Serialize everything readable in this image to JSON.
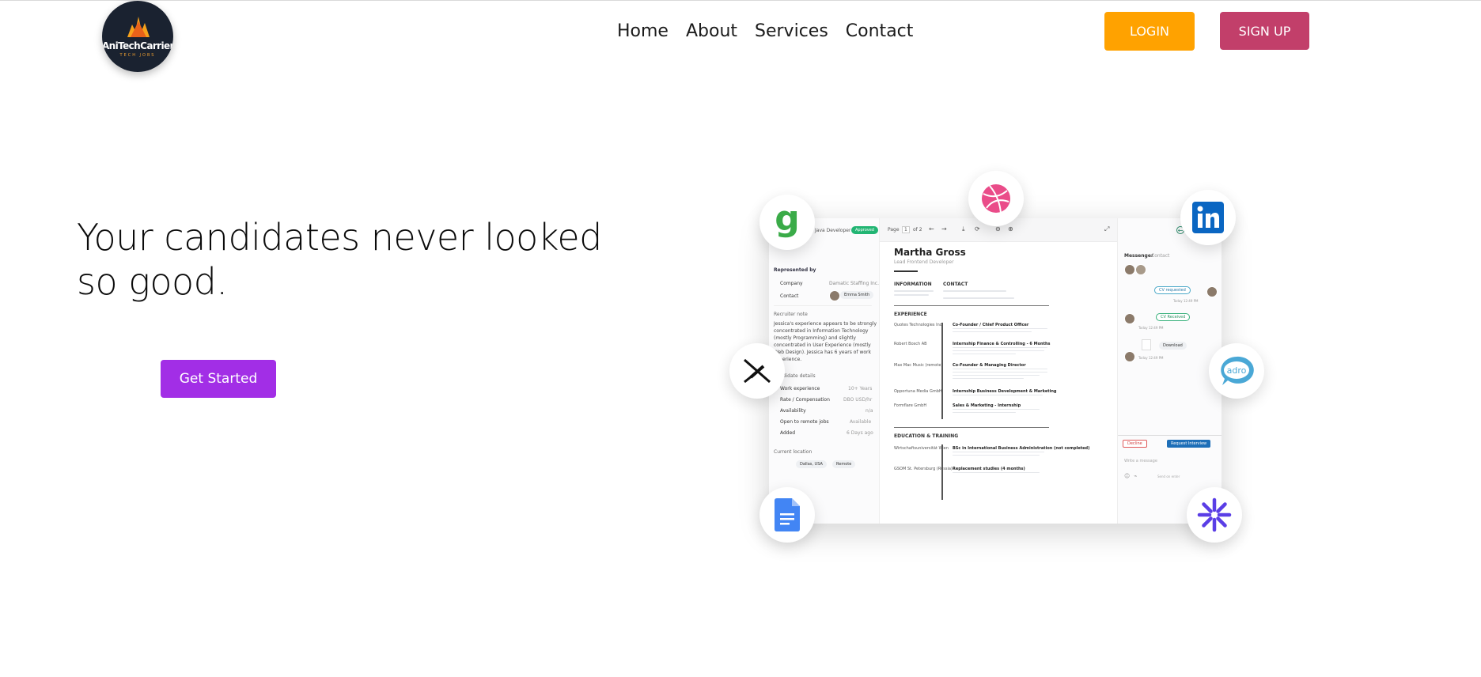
{
  "header": {
    "logo": {
      "brand": "AniTechCarrier",
      "tagline": "TECH JOBS"
    },
    "nav": [
      "Home",
      "About",
      "Services",
      "Contact"
    ],
    "login_label": "LOGIN",
    "signup_label": "SIGN UP"
  },
  "hero": {
    "headline_line1": "Your candidates never looked",
    "headline_line2": "so good.",
    "cta_label": "Get Started"
  },
  "illustration": {
    "job_title": "Java Developer",
    "status_chip": "Approved",
    "represented_by": "Represented by",
    "company_label": "Company",
    "company_value": "Damatic Staffing Inc.",
    "contact_label": "Contact",
    "contact_value": "Emma Smith",
    "recruiter_note": "Recruiter note",
    "note_text": [
      "Jessica's experience appears to be strongly",
      "concentrated in Information Technology",
      "(mostly Programming) and slightly",
      "concentrated in User Experience (mostly",
      "Web Design). Jessica has 6 years of work",
      "experience."
    ],
    "candidate_details": "Candidate details",
    "details": [
      {
        "label": "Work experience",
        "value": "10+ Years"
      },
      {
        "label": "Rate / Compensation",
        "value": "DBO USD/hr"
      },
      {
        "label": "Availability",
        "value": "n/a"
      },
      {
        "label": "Open to remote jobs",
        "value": "Available"
      },
      {
        "label": "Added",
        "value": "6 Days ago"
      }
    ],
    "current_location": "Current location",
    "location_chip": "Dallas, USA",
    "remote_chip": "Remote",
    "page_label": "Page",
    "page_num": "1",
    "page_of": "of 2",
    "cv_name": "Martha Gross",
    "cv_role": "Lead Frontend Developer",
    "information_h": "INFORMATION",
    "contact_h": "CONTACT",
    "experience_h": "EXPERIENCE",
    "education_h": "EDUCATION & TRAINING",
    "experience": [
      {
        "company": "Quotes Technologies Inc.",
        "title": "Co-Founder / Chief Product Officer"
      },
      {
        "company": "Robert Bosch AB",
        "title": "Internship Finance & Controlling - 6 Months"
      },
      {
        "company": "Max Mac Music (remote)",
        "title": "Co-Founder & Managing Director"
      },
      {
        "company": "Opportuna Media GmbH",
        "title": "Internship Business Development & Marketing"
      },
      {
        "company": "Formflare GmbH",
        "title": "Sales & Marketing - Internship"
      }
    ],
    "education": [
      {
        "school": "Wirtschaftsuniversität Wien",
        "degree": "BSc in International Business Administration (not completed)"
      },
      {
        "school": "GSOM St. Petersburg (Russia)",
        "degree": "Replacement studies (4 months)"
      }
    ],
    "messenger_tab": "Messenger",
    "contact_tab": "Contact",
    "msg_cv_requested": "CV requested",
    "msg_time1": "Today 12:49 PM",
    "msg_cv_received": "CV Received",
    "msg_time2": "Today 12:49 PM",
    "msg_download": "Download",
    "msg_time3": "Today 12:49 PM",
    "decline_label": "Decline",
    "request_interview_label": "Request Interview",
    "write_message": "Write a message",
    "send_label": "Send on enter"
  },
  "colors": {
    "login": "#ffa200",
    "signup": "#c23f6a",
    "cta": "#a22ee6",
    "logo_bg": "#1a2230"
  }
}
